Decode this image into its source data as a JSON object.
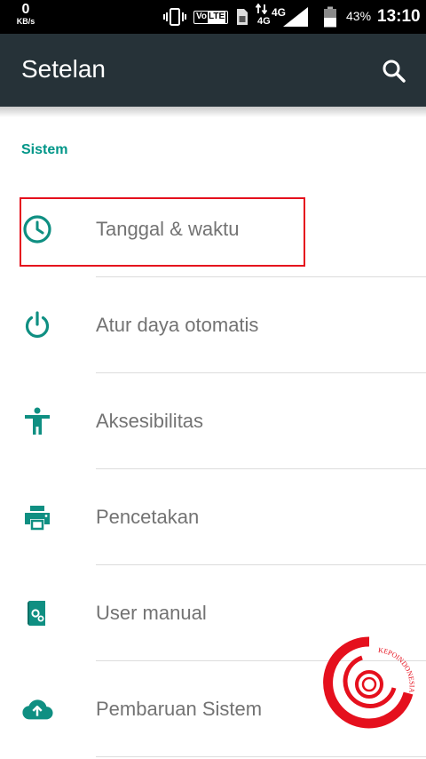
{
  "status_bar": {
    "net_speed_value": "0",
    "net_speed_unit": "KB/s",
    "volte_left": "Vo",
    "volte_right": "LTE",
    "net_type_top": "4G",
    "net_type_bottom": "4G",
    "battery_percent": "43%",
    "time": "13:10",
    "icons": [
      "vibrate-icon",
      "volte-icon",
      "sim-card-icon",
      "data-arrows-icon",
      "signal-icon",
      "battery-icon"
    ]
  },
  "app_bar": {
    "title": "Setelan",
    "search_icon": "search-icon",
    "background": "#263238"
  },
  "section": {
    "title": "Sistem",
    "color": "#009688"
  },
  "items": [
    {
      "label": "Tanggal & waktu",
      "icon": "clock-icon"
    },
    {
      "label": "Atur daya otomatis",
      "icon": "power-icon"
    },
    {
      "label": "Aksesibilitas",
      "icon": "accessibility-icon"
    },
    {
      "label": "Pencetakan",
      "icon": "print-icon"
    },
    {
      "label": "User manual",
      "icon": "user-manual-icon"
    },
    {
      "label": "Pembaruan Sistem",
      "icon": "cloud-upload-icon"
    }
  ],
  "highlight": {
    "target": "Tanggal & waktu",
    "color": "#e5101d"
  },
  "watermark": {
    "text": "KEPOINDONESIA",
    "color": "#e5101d"
  }
}
